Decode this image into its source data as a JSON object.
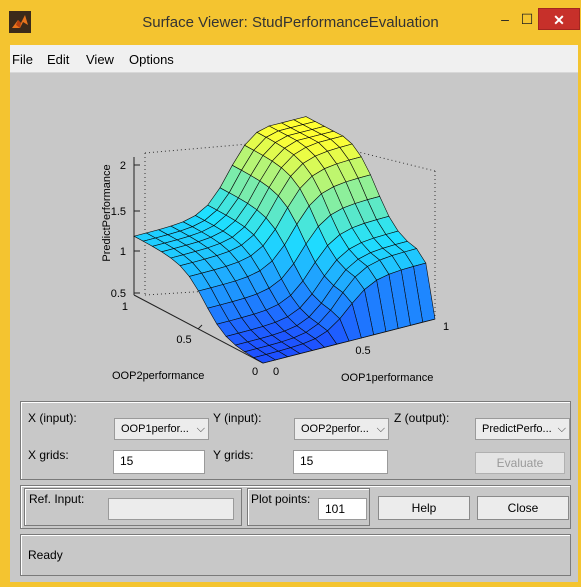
{
  "window": {
    "title": "Surface Viewer: StudPerformanceEvaluation",
    "minimize_glyph": "‒",
    "maximize_glyph": "☐",
    "close_glyph": "✕"
  },
  "menu": [
    "File",
    "Edit",
    "View",
    "Options"
  ],
  "plot": {
    "z_label": "PredictPerformance",
    "y_label": "OOP2performance",
    "x_label": "OOP1performance",
    "z_ticks": [
      "2",
      "1.5",
      "1",
      "0.5"
    ],
    "y_ticks": [
      "1",
      "0.5",
      "0"
    ],
    "x_ticks": [
      "0",
      "0.5",
      "1"
    ],
    "colors": {
      "low": "#1e50ff",
      "mid": "#1fe0ff",
      "high": "#ffff33"
    }
  },
  "controls": {
    "x_input_label": "X (input):",
    "x_input_value": "OOP1perfor...",
    "y_input_label": "Y (input):",
    "y_input_value": "OOP2perfor...",
    "z_output_label": "Z (output):",
    "z_output_value": "PredictPerfo...",
    "x_grids_label": "X grids:",
    "x_grids_value": "15",
    "y_grids_label": "Y grids:",
    "y_grids_value": "15",
    "evaluate_label": "Evaluate",
    "ref_input_label": "Ref. Input:",
    "ref_input_value": "",
    "plot_points_label": "Plot points:",
    "plot_points_value": "101",
    "help_label": "Help",
    "close_label": "Close"
  },
  "status": {
    "text": "Ready"
  }
}
